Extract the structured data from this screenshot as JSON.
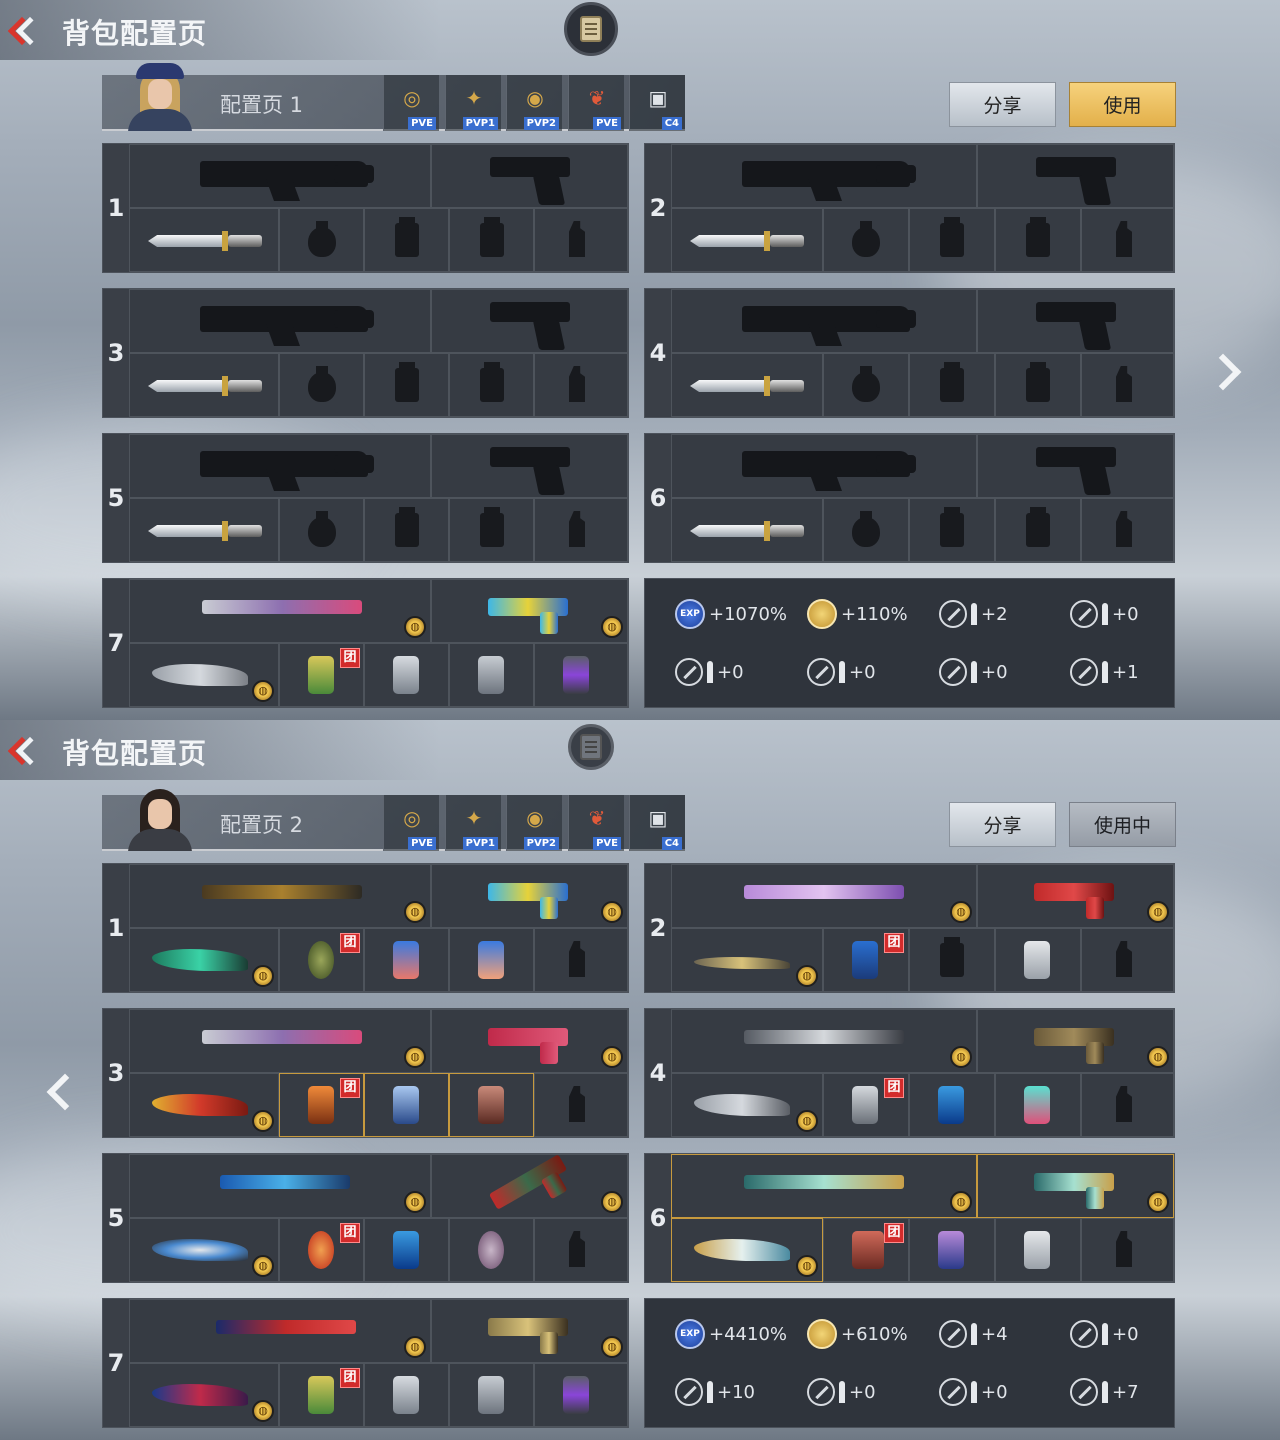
{
  "screens": [
    {
      "title": "背包配置页",
      "config_name": "配置页 1",
      "avatar": "blonde-female-officer",
      "modes": [
        {
          "icon": "ring-icon",
          "tag": "PVE"
        },
        {
          "icon": "gold-wing-icon",
          "tag": "PVP1"
        },
        {
          "icon": "ring-icon",
          "tag": "PVP2"
        },
        {
          "icon": "red-feather-icon",
          "tag": "PVE"
        },
        {
          "icon": "c4-icon",
          "tag": "C4"
        }
      ],
      "share_label": "分享",
      "use_label": "使用",
      "loadouts": [
        "1",
        "2",
        "3",
        "4",
        "5",
        "6",
        "7"
      ],
      "bonuses": [
        {
          "icon": "exp-icon",
          "text": "+1070%"
        },
        {
          "icon": "gold-coin-icon",
          "text": "+110%"
        },
        {
          "icon": "sniper-ammo-icon",
          "text": "+2"
        },
        {
          "icon": "rifle-ammo-icon",
          "text": "+0"
        },
        {
          "icon": "smg-ammo-icon",
          "text": "+0"
        },
        {
          "icon": "mg-ammo-icon",
          "text": "+0"
        },
        {
          "icon": "shotgun-ammo-icon",
          "text": "+0"
        },
        {
          "icon": "pistol-ammo-icon",
          "text": "+1"
        }
      ]
    },
    {
      "title": "背包配置页",
      "config_name": "配置页 2",
      "avatar": "dark-hair-female",
      "modes": [
        {
          "icon": "ring-icon",
          "tag": "PVE"
        },
        {
          "icon": "gold-wing-icon",
          "tag": "PVP1"
        },
        {
          "icon": "ring-icon",
          "tag": "PVP2"
        },
        {
          "icon": "red-feather-icon",
          "tag": "PVE"
        },
        {
          "icon": "c4-icon",
          "tag": "C4"
        }
      ],
      "share_label": "分享",
      "use_label": "使用中",
      "loadouts": [
        "1",
        "2",
        "3",
        "4",
        "5",
        "6",
        "7"
      ],
      "tuan_label": "团",
      "bonuses": [
        {
          "icon": "exp-icon",
          "text": "+4410%"
        },
        {
          "icon": "gold-coin-icon",
          "text": "+610%"
        },
        {
          "icon": "sniper-ammo-icon",
          "text": "+4"
        },
        {
          "icon": "rifle-ammo-icon",
          "text": "+0"
        },
        {
          "icon": "smg-ammo-icon",
          "text": "+10"
        },
        {
          "icon": "mg-ammo-icon",
          "text": "+0"
        },
        {
          "icon": "shotgun-ammo-icon",
          "text": "+0"
        },
        {
          "icon": "pistol-ammo-icon",
          "text": "+7"
        }
      ]
    }
  ],
  "colors": {
    "accent_use": "#e3b04a",
    "panel": "#2f343c",
    "back_arrow": "#d9352c",
    "tuan_badge": "#d22b2b"
  }
}
